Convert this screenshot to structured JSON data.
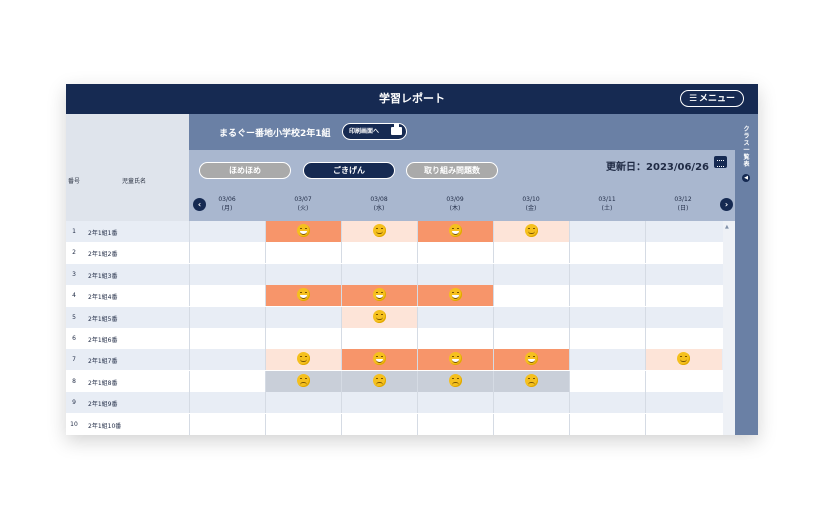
{
  "header": {
    "title": "学習レポート",
    "menu_label": "メニュー",
    "menu_icon": "hamburger-icon"
  },
  "class_bar": {
    "class_name": "まるぐー番地小学校2年1組",
    "print_label": "印刷画面へ"
  },
  "filters": [
    {
      "label": "ほめほめ",
      "active": false
    },
    {
      "label": "ごきげん",
      "active": true
    },
    {
      "label": "取り組み問題数",
      "active": false
    }
  ],
  "update": {
    "label": "更新日：2023/06/26"
  },
  "columns": {
    "number": "番号",
    "name": "児童氏名"
  },
  "days": [
    {
      "date": "03/06",
      "dow": "(月)"
    },
    {
      "date": "03/07",
      "dow": "(火)"
    },
    {
      "date": "03/08",
      "dow": "(水)"
    },
    {
      "date": "03/09",
      "dow": "(木)"
    },
    {
      "date": "03/10",
      "dow": "(金)"
    },
    {
      "date": "03/11",
      "dow": "(土)"
    },
    {
      "date": "03/12",
      "dow": "(日)"
    }
  ],
  "sidebar": {
    "label": "クラス一覧表"
  },
  "students": [
    {
      "no": "1",
      "name": "2年1組1番",
      "cells": [
        "",
        "orange:grin",
        "pink:smile",
        "orange:grin",
        "pink:smile",
        "",
        ""
      ]
    },
    {
      "no": "2",
      "name": "2年1組2番",
      "cells": [
        "",
        "",
        "",
        "",
        "",
        "",
        ""
      ]
    },
    {
      "no": "3",
      "name": "2年1組3番",
      "cells": [
        "",
        "",
        "",
        "",
        "",
        "",
        ""
      ]
    },
    {
      "no": "4",
      "name": "2年1組4番",
      "cells": [
        "",
        "orange:grin",
        "orange:grin",
        "orange:grin",
        "",
        "",
        ""
      ]
    },
    {
      "no": "5",
      "name": "2年1組5番",
      "cells": [
        "",
        "",
        "pink:smile",
        "",
        "",
        "",
        ""
      ]
    },
    {
      "no": "6",
      "name": "2年1組6番",
      "cells": [
        "",
        "",
        "",
        "",
        "",
        "",
        ""
      ]
    },
    {
      "no": "7",
      "name": "2年1組7番",
      "cells": [
        "",
        "pink:smile",
        "orange:grin",
        "orange:grin",
        "orange:grin",
        "",
        "pink:smile"
      ]
    },
    {
      "no": "8",
      "name": "2年1組8番",
      "cells": [
        "",
        "grey:frown",
        "grey:frown",
        "grey:frown",
        "grey:frown",
        "",
        ""
      ]
    },
    {
      "no": "9",
      "name": "2年1組9番",
      "cells": [
        "",
        "",
        "",
        "",
        "",
        "",
        ""
      ]
    },
    {
      "no": "10",
      "name": "2年1組10番",
      "cells": [
        "",
        "",
        "",
        "",
        "",
        "",
        ""
      ]
    }
  ]
}
